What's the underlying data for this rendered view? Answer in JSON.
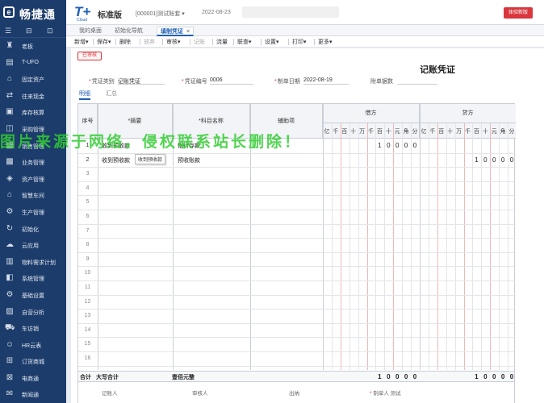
{
  "brand": {
    "name": "畅捷通",
    "logo_char": "e"
  },
  "product": {
    "logo": "T+",
    "logo_sub": "Cloud",
    "edition": "标准版",
    "account": "[000001]测试账套 ▾",
    "date": "2022-08-23"
  },
  "header": {
    "trial_button": "体验新版"
  },
  "sidebar": {
    "tools": [
      "☰",
      "⊟",
      "⊡"
    ],
    "items": [
      {
        "label": "老板",
        "icon": "boss-icon",
        "glyph": "♜"
      },
      {
        "label": "T-UFO",
        "icon": "report-icon",
        "glyph": "▤"
      },
      {
        "label": "固定资产",
        "icon": "bank-icon",
        "glyph": "⌂"
      },
      {
        "label": "往来现金",
        "icon": "cash-icon",
        "glyph": "⇄"
      },
      {
        "label": "库存核算",
        "icon": "inventory-icon",
        "glyph": "▣"
      },
      {
        "label": "采购管理",
        "icon": "cart-icon",
        "glyph": "◫"
      },
      {
        "label": "销售管理",
        "icon": "sales-icon",
        "glyph": "▦"
      },
      {
        "label": "业务管理",
        "icon": "business-icon",
        "glyph": "▩"
      },
      {
        "label": "资产管理",
        "icon": "asset-icon",
        "glyph": "◈"
      },
      {
        "label": "智慧车间",
        "icon": "workshop-icon",
        "glyph": "⌂"
      },
      {
        "label": "生产管理",
        "icon": "production-icon",
        "glyph": "⚙"
      },
      {
        "label": "初始化",
        "icon": "init-icon",
        "glyph": "↻"
      },
      {
        "label": "云应用",
        "icon": "cloud-icon",
        "glyph": "☁"
      },
      {
        "label": "物料需求计划",
        "icon": "mrp-icon",
        "glyph": "▥"
      },
      {
        "label": "系统管理",
        "icon": "system-icon",
        "glyph": "◧"
      },
      {
        "label": "基础设置",
        "icon": "settings-icon",
        "glyph": "⚙"
      },
      {
        "label": "自营分析",
        "icon": "analysis-icon",
        "glyph": "▨"
      },
      {
        "label": "车访销",
        "icon": "car-icon",
        "glyph": "⛟"
      },
      {
        "label": "HR云表",
        "icon": "hr-icon",
        "glyph": "☺"
      },
      {
        "label": "订货商城",
        "icon": "mall-icon",
        "glyph": "⊞"
      },
      {
        "label": "电商通",
        "icon": "ecommerce-icon",
        "glyph": "⊠"
      },
      {
        "label": "新闻通",
        "icon": "news-icon",
        "glyph": "✉"
      }
    ]
  },
  "tabs": [
    {
      "label": "我的桌面"
    },
    {
      "label": "初始化导航"
    },
    {
      "label": "填制凭证",
      "close": "×"
    }
  ],
  "toolbar": [
    {
      "label": "新增▾"
    },
    {
      "label": "保存▾"
    },
    {
      "label": "删除"
    },
    {
      "label": "放弃"
    },
    {
      "label": "审核▾"
    },
    {
      "label": "记账"
    },
    {
      "label": "流量"
    },
    {
      "label": "联查▾"
    },
    {
      "label": "设置▾"
    },
    {
      "label": "打印▾"
    },
    {
      "label": "更多▾"
    }
  ],
  "voucher": {
    "status": "已审核",
    "title": "记账凭证",
    "fields": {
      "type_label": "凭证类别",
      "type_value": "记账凭证",
      "no_label": "凭证编号",
      "no_value": "0006",
      "date_label": "制单日期",
      "date_value": "2022-08-19",
      "attach_label": "附单据数"
    },
    "subtabs": [
      "明细",
      "汇总"
    ]
  },
  "grid": {
    "headers": {
      "no": "序号",
      "summary": "*摘要",
      "account": "*科目名称",
      "aux": "辅助项",
      "debit": "借方",
      "credit": "贷方"
    },
    "digit_units": [
      "亿",
      "千",
      "百",
      "十",
      "万",
      "千",
      "百",
      "十",
      "元",
      "角",
      "分"
    ],
    "rows": [
      {
        "no": "1",
        "summary": "收到预收款",
        "account": "银行存款",
        "debit": [
          "1",
          "0",
          "0",
          "0",
          "0"
        ],
        "credit": []
      },
      {
        "no": "2",
        "summary": "收到预收款",
        "account": "预收账款",
        "debit": [],
        "credit": [
          "1",
          "0",
          "0",
          "0",
          "0"
        ]
      },
      {
        "no": "3"
      },
      {
        "no": "4"
      },
      {
        "no": "5"
      },
      {
        "no": "6"
      },
      {
        "no": "7"
      },
      {
        "no": "8"
      },
      {
        "no": "9"
      },
      {
        "no": "10"
      },
      {
        "no": "11"
      },
      {
        "no": "12"
      },
      {
        "no": "13"
      },
      {
        "no": "14"
      },
      {
        "no": "15"
      },
      {
        "no": "16"
      }
    ],
    "tooltip": "收到预收款"
  },
  "total": {
    "label": "合计",
    "capital_label": "大写合计",
    "capital_value": "壹佰元整",
    "debit": [
      "1",
      "0",
      "0",
      "0",
      "0"
    ],
    "credit": [
      "1",
      "0",
      "0",
      "0",
      "0"
    ]
  },
  "signers": [
    {
      "label": "记账人"
    },
    {
      "label": "审核人"
    },
    {
      "label": "出纳"
    },
    {
      "label": "制单人",
      "value": "测试",
      "required": true
    }
  ],
  "watermark": "图片来源于网络，侵权联系站长删除！"
}
